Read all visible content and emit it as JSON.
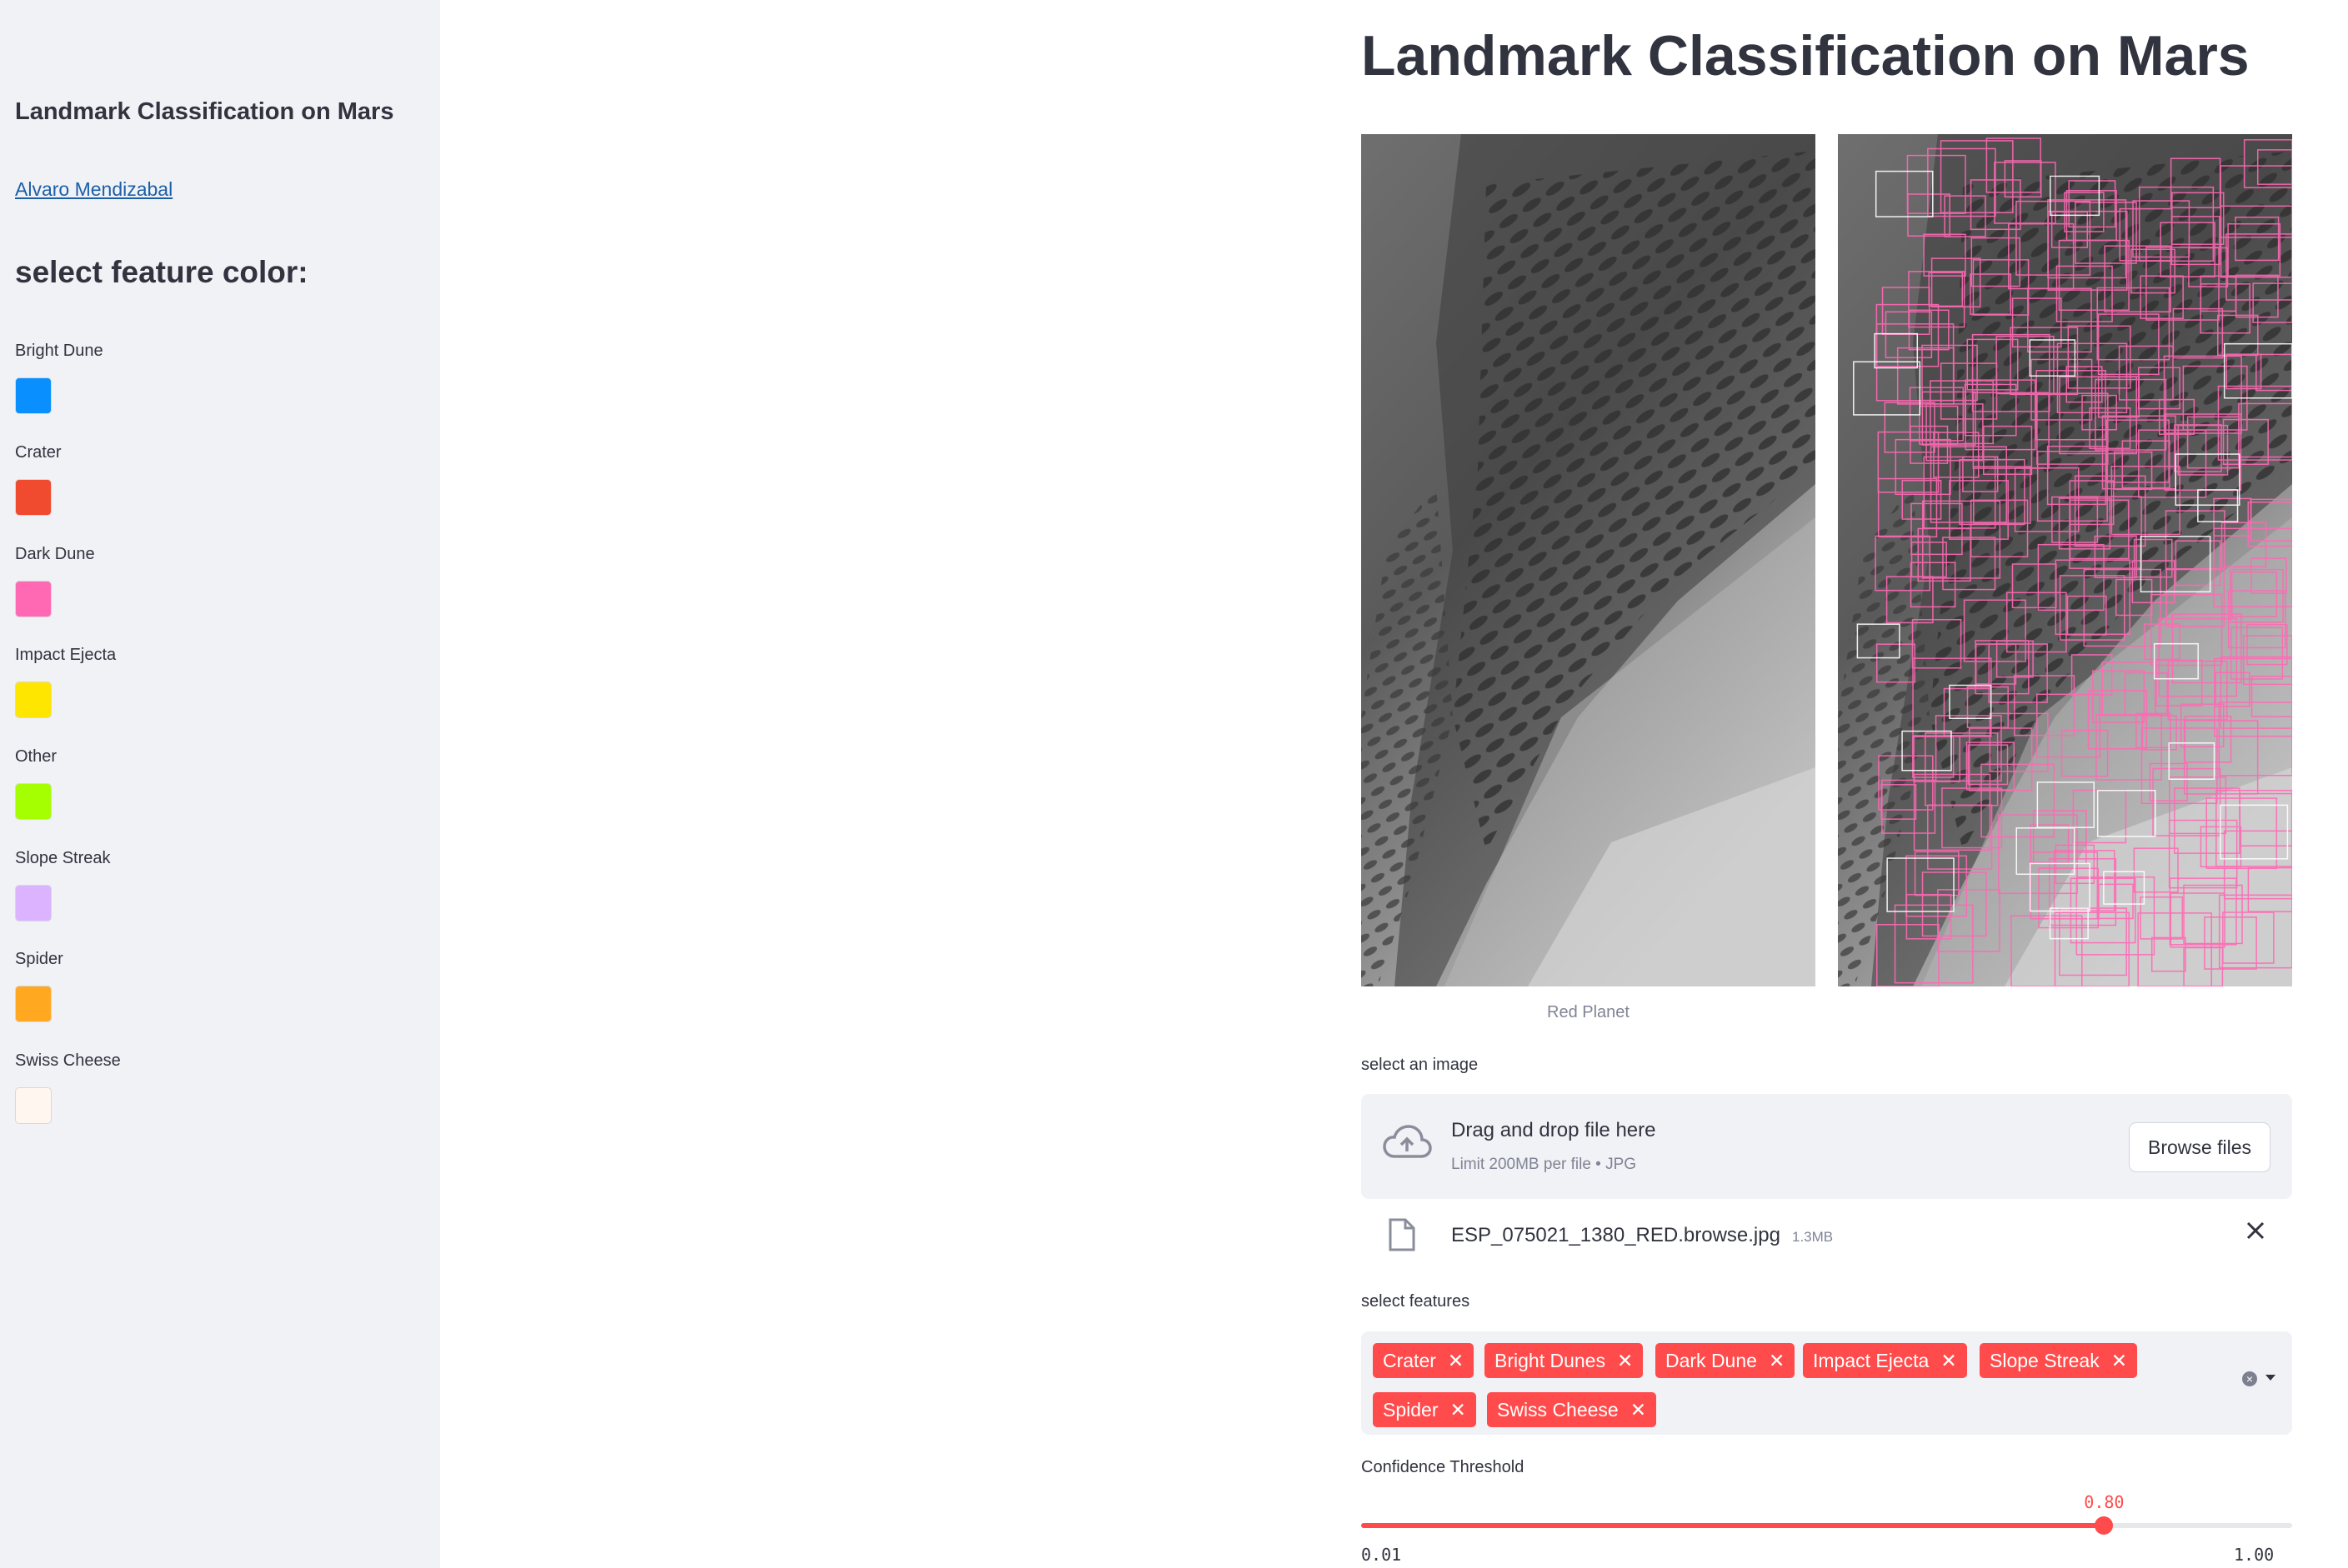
{
  "sidebar": {
    "title": "Landmark Classification on Mars",
    "author_link": "Alvaro Mendizabal",
    "color_heading": "select feature color:",
    "colors": [
      {
        "label": "Bright Dune",
        "color": "#0a8fff"
      },
      {
        "label": "Crater",
        "color": "#f04a2f"
      },
      {
        "label": "Dark Dune",
        "color": "#ff69b4"
      },
      {
        "label": "Impact Ejecta",
        "color": "#ffe600"
      },
      {
        "label": "Other",
        "color": "#a6ff00"
      },
      {
        "label": "Slope Streak",
        "color": "#dcb3ff"
      },
      {
        "label": "Spider",
        "color": "#ffa820"
      },
      {
        "label": "Swiss Cheese",
        "color": "#fff6f0"
      }
    ]
  },
  "main": {
    "title": "Landmark Classification on Mars",
    "caption": "Red Planet"
  },
  "uploader": {
    "label": "select an image",
    "drop_text": "Drag and drop file here",
    "limit_text": "Limit 200MB per file • JPG",
    "browse_label": "Browse files",
    "file_name": "ESP_075021_1380_RED.browse.jpg",
    "file_size": "1.3MB"
  },
  "features": {
    "label": "select features",
    "tags": [
      "Crater",
      "Bright Dunes",
      "Dark Dune",
      "Impact Ejecta",
      "Slope Streak",
      "Spider",
      "Swiss Cheese"
    ]
  },
  "slider": {
    "label": "Confidence Threshold",
    "value": "0.80",
    "min": "0.01",
    "max": "1.00",
    "fraction": 0.798
  }
}
